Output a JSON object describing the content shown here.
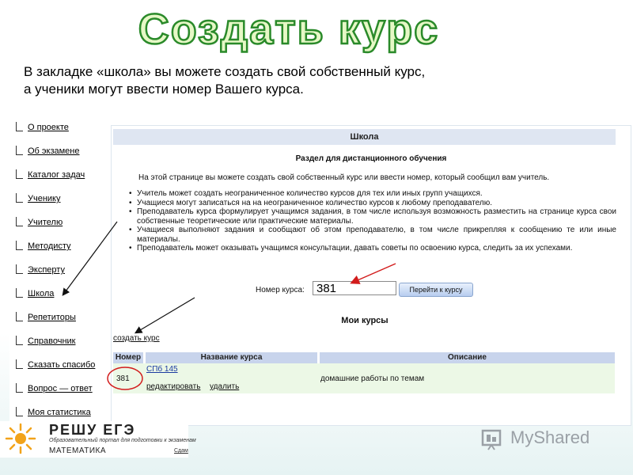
{
  "slide": {
    "title": "Создать курс",
    "subtitle_lines": [
      "В закладке «школа» вы можете создать свой собственный курс,",
      "а ученики могут ввести номер Вашего курса."
    ]
  },
  "menu": {
    "items": [
      {
        "label": "О проекте"
      },
      {
        "label": "Об экзамене"
      },
      {
        "label": "Каталог задач"
      },
      {
        "label": "Ученику"
      },
      {
        "label": "Учителю"
      },
      {
        "label": "Методисту"
      },
      {
        "label": "Эксперту"
      },
      {
        "label": "Школа"
      },
      {
        "label": "Репетиторы"
      },
      {
        "label": "Справочник"
      },
      {
        "label": "Сказать спасибо"
      },
      {
        "label": "Вопрос — ответ"
      },
      {
        "label": "Моя статистика"
      }
    ]
  },
  "panel": {
    "header": "Школа",
    "section_title": "Раздел для дистанционного обучения",
    "intro": "На этой странице вы можете создать свой собственный курс или ввести номер, который сообщил вам учитель.",
    "rules": [
      "Учитель может создать неограниченное количество курсов для тех или иных групп учащихся.",
      "Учащиеся могут записаться на на неограниченное количество курсов к любому преподавателю.",
      "Преподаватель курса формулирует учащимся задания, в том числе используя возможность разместить на странице курса свои собственные теоретические или практические материалы.",
      "Учащиеся выполняют задания и сообщают об этом преподавателю, в том числе прикрепляя к сообщению те или иные материалы.",
      "Преподаватель может оказывать учащимся консультации, давать советы по освоению курса, следить за их успехами."
    ],
    "course_number_label": "Номер курса:",
    "course_number_value": "381",
    "go_button": "Перейти к курсу",
    "my_courses_title": "Мои курсы",
    "create_course_link": "создать курс",
    "table": {
      "headers": [
        "Номер",
        "Название курса",
        "Описание"
      ],
      "rows": [
        {
          "number": "381",
          "name": "СПб 145",
          "edit": "редактировать",
          "delete": "удалить",
          "description": "домашние работы по темам"
        }
      ]
    }
  },
  "logo": {
    "name": "РЕШУ ЕГЭ",
    "tagline": "Образовательный портал для подготовки к экзаменам",
    "subject": "МАТЕМАТИКА",
    "link": "Сдам"
  },
  "watermark": {
    "text": "MyShared"
  },
  "colors": {
    "title_fill": "#e6f8c6",
    "title_stroke": "#2a8a2a",
    "panel_header_bg": "#dfe6f2",
    "table_header_bg": "#c8d4ec",
    "row_bg": "#ecf8e6",
    "arrow_red": "#d21c1c"
  }
}
